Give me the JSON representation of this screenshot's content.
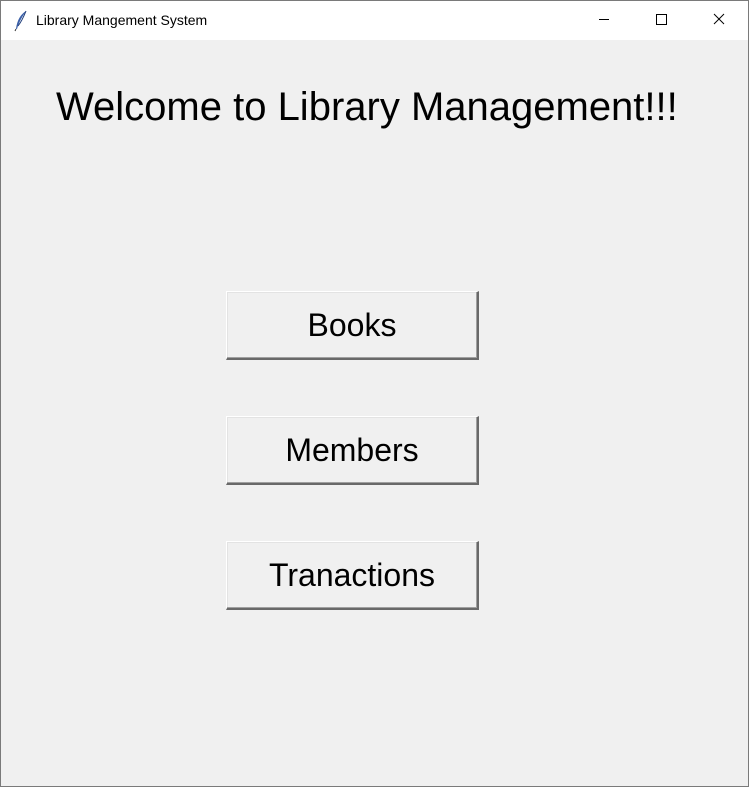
{
  "window": {
    "title": "Library Mangement System",
    "icon": "feather-icon"
  },
  "controls": {
    "minimize": "minimize-icon",
    "maximize": "maximize-icon",
    "close": "close-icon"
  },
  "main": {
    "heading": "Welcome to Library Management!!!",
    "buttons": {
      "books": "Books",
      "members": "Members",
      "transactions": "Tranactions"
    }
  },
  "colors": {
    "background": "#f0f0f0",
    "titlebar": "#ffffff",
    "text": "#000000"
  }
}
